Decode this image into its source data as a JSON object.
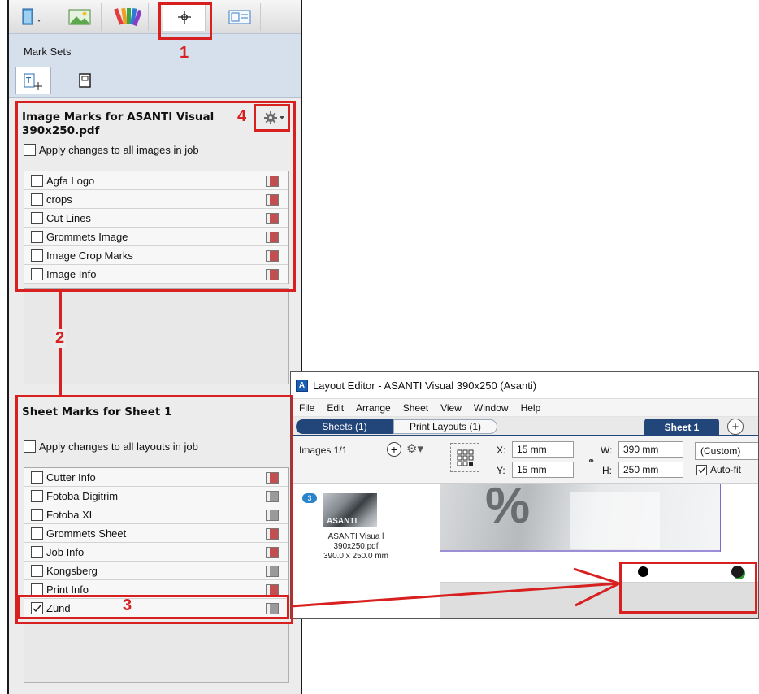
{
  "left_panel": {
    "toolbar_icons": [
      "book-icon",
      "image-icon",
      "color-swatch-icon",
      "marks-crosshair-icon",
      "layout-icon"
    ],
    "mark_sets_label": "Mark Sets",
    "subtab_icons": [
      "text-mark-icon",
      "page-icon"
    ]
  },
  "image_marks": {
    "title": "Image Marks for ASANTI Visual 390x250.pdf",
    "apply_label": "Apply changes to all images in job",
    "apply_checked": false,
    "items": [
      {
        "label": "Agfa Logo",
        "checked": false
      },
      {
        "label": "crops",
        "checked": false
      },
      {
        "label": "Cut Lines",
        "checked": false
      },
      {
        "label": "Grommets Image",
        "checked": false
      },
      {
        "label": "Image Crop Marks",
        "checked": false
      },
      {
        "label": "Image Info",
        "checked": false
      }
    ]
  },
  "sheet_marks": {
    "title": "Sheet Marks for Sheet 1",
    "apply_label": "Apply changes to all layouts in job",
    "apply_checked": false,
    "items": [
      {
        "label": "Cutter Info",
        "checked": false
      },
      {
        "label": "Fotoba Digitrim",
        "checked": false
      },
      {
        "label": "Fotoba XL",
        "checked": false
      },
      {
        "label": "Grommets Sheet",
        "checked": false
      },
      {
        "label": "Job Info",
        "checked": false
      },
      {
        "label": "Kongsberg",
        "checked": false
      },
      {
        "label": "Print Info",
        "checked": false
      },
      {
        "label": "Zünd",
        "checked": true
      }
    ]
  },
  "annotations": {
    "n1": "1",
    "n2": "2",
    "n3": "3",
    "n4": "4",
    "color": "#d82020"
  },
  "layout_editor": {
    "app_icon": "A",
    "title": "Layout Editor - ASANTI Visual 390x250 (Asanti)",
    "menu": [
      "File",
      "Edit",
      "Arrange",
      "Sheet",
      "View",
      "Window",
      "Help"
    ],
    "tabs": {
      "sheets": "Sheets (1)",
      "print_layouts": "Print Layouts (1)",
      "sheet": "Sheet 1",
      "add": "+"
    },
    "images_label": "Images 1/1",
    "x_label": "X:",
    "x_value": "15 mm",
    "y_label": "Y:",
    "y_value": "15 mm",
    "w_label": "W:",
    "w_value": "390 mm",
    "h_label": "H:",
    "h_value": "250 mm",
    "preset": "(Custom)",
    "autofit_label": "Auto-fit",
    "autofit_checked": true,
    "image_count": "3",
    "thumb_name": "ASANTI Visua l 390x250.pdf",
    "thumb_size": "390.0 x 250.0 mm",
    "thumb_overlay_text": "ASANTI"
  },
  "colors": {
    "accent_blue": "#22457a",
    "annotation_red": "#d82020",
    "swatch_red": "#c05050"
  }
}
